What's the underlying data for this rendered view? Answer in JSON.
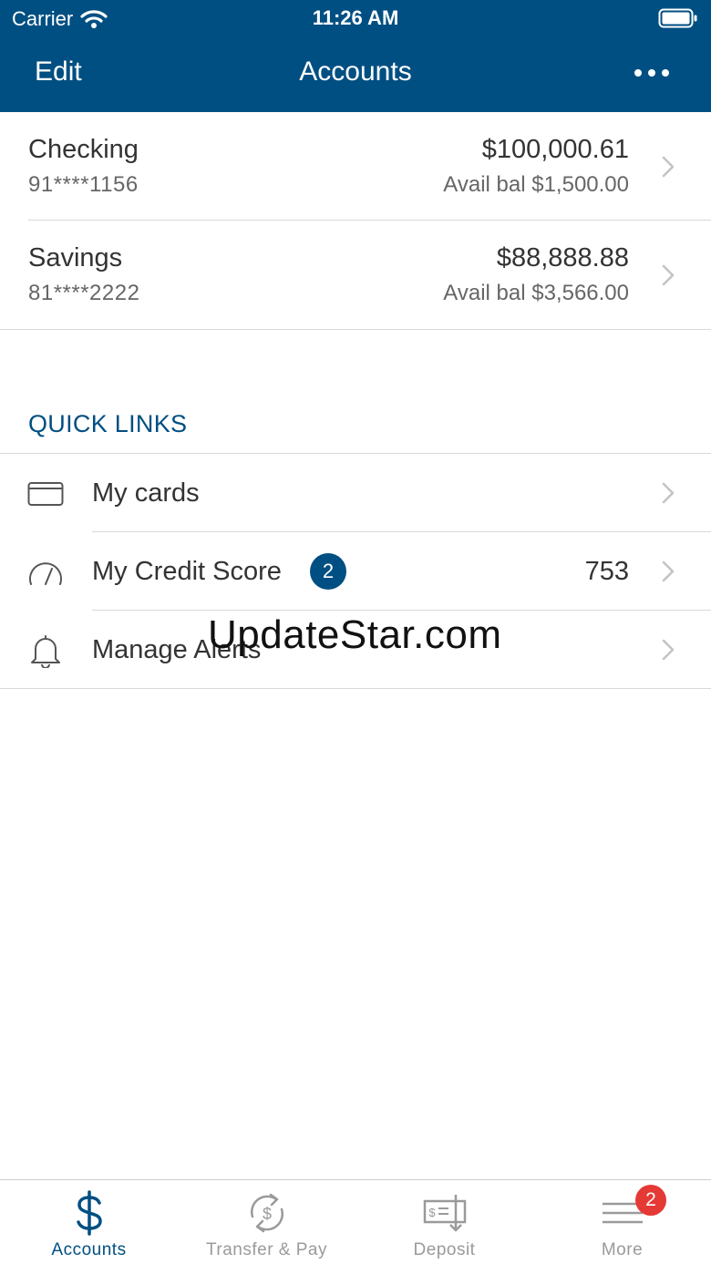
{
  "status_bar": {
    "carrier": "Carrier",
    "time": "11:26 AM"
  },
  "nav": {
    "edit_label": "Edit",
    "title": "Accounts"
  },
  "accounts": [
    {
      "name": "Checking",
      "number": "91****1156",
      "balance": "$100,000.61",
      "available": "Avail bal $1,500.00"
    },
    {
      "name": "Savings",
      "number": "81****2222",
      "balance": "$88,888.88",
      "available": "Avail bal $3,566.00"
    }
  ],
  "quick_links": {
    "header": "QUICK LINKS",
    "items": [
      {
        "icon": "card-icon",
        "label": "My cards"
      },
      {
        "icon": "gauge-icon",
        "label": "My Credit Score",
        "badge": "2",
        "value": "753"
      },
      {
        "icon": "bell-icon",
        "label": "Manage Alerts"
      }
    ]
  },
  "watermark": "UpdateStar.com",
  "tab_bar": {
    "tabs": [
      {
        "icon": "dollar-icon",
        "label": "Accounts",
        "active": true
      },
      {
        "icon": "transfer-icon",
        "label": "Transfer & Pay"
      },
      {
        "icon": "deposit-icon",
        "label": "Deposit"
      },
      {
        "icon": "menu-icon",
        "label": "More",
        "badge": "2"
      }
    ]
  },
  "colors": {
    "brand": "#004f82",
    "badge_alert": "#e53935",
    "inactive": "#9a9a9a"
  }
}
